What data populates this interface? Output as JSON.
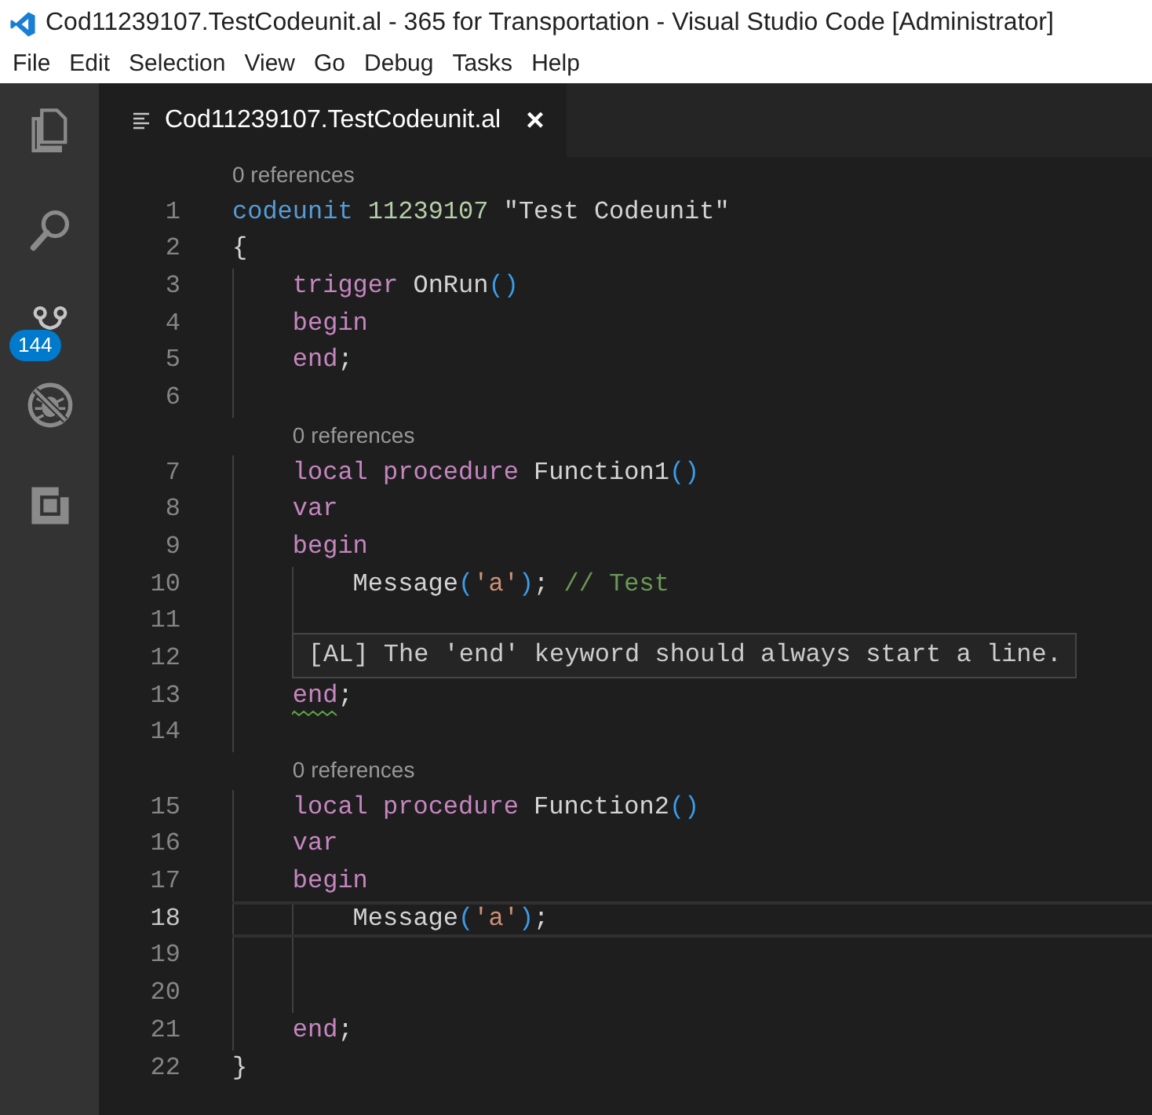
{
  "window": {
    "title": "Cod11239107.TestCodeunit.al - 365 for Transportation - Visual Studio Code [Administrator]"
  },
  "menu": [
    "File",
    "Edit",
    "Selection",
    "View",
    "Go",
    "Debug",
    "Tasks",
    "Help"
  ],
  "activity_bar": [
    {
      "kind": "files"
    },
    {
      "kind": "search"
    },
    {
      "kind": "source-control",
      "badge": "144"
    },
    {
      "kind": "debug"
    },
    {
      "kind": "extensions"
    }
  ],
  "tabs": [
    {
      "label": "Cod11239107.TestCodeunit.al",
      "close": "×",
      "selected": true
    }
  ],
  "lines": [
    {
      "number": "1",
      "lens": "0 references",
      "current": false,
      "tokens": [
        {
          "kind": "keyword",
          "text": "codeunit"
        },
        {
          "kind": "number",
          "text": " 11239107"
        },
        {
          "kind": "plain",
          "text": " \"Test Codeunit\""
        }
      ]
    },
    {
      "number": "2",
      "current": false,
      "tokens": [
        {
          "kind": "plain",
          "text": "{"
        }
      ],
      "children": [
        {
          "number": "3",
          "current": false,
          "tokens": [
            {
              "kind": "control",
              "text": "trigger"
            },
            {
              "kind": "plain",
              "text": " OnRun"
            },
            {
              "kind": "paren",
              "text": "()"
            }
          ]
        },
        {
          "number": "4",
          "current": false,
          "tokens": [
            {
              "kind": "control",
              "text": "begin"
            }
          ]
        },
        {
          "number": "5",
          "current": false,
          "tokens": [
            {
              "kind": "control",
              "text": "end"
            },
            {
              "kind": "plain",
              "text": ";"
            }
          ]
        },
        {
          "number": "6",
          "current": false
        },
        {
          "number": "7",
          "lens": "0 references",
          "current": false,
          "tokens": [
            {
              "kind": "control",
              "text": "local"
            },
            {
              "kind": "control",
              "text": " procedure"
            },
            {
              "kind": "plain",
              "text": " Function1"
            },
            {
              "kind": "paren",
              "text": "()"
            }
          ]
        },
        {
          "number": "8",
          "current": false,
          "tokens": [
            {
              "kind": "control",
              "text": "var"
            }
          ]
        },
        {
          "number": "9",
          "current": false,
          "tokens": [
            {
              "kind": "control",
              "text": "begin"
            }
          ],
          "children": [
            {
              "number": "10",
              "current": false,
              "tokens": [
                {
                  "kind": "plain",
                  "text": "Message"
                },
                {
                  "kind": "paren",
                  "text": "("
                },
                {
                  "kind": "string",
                  "text": "'a'"
                },
                {
                  "kind": "paren",
                  "text": ")"
                },
                {
                  "kind": "plain",
                  "text": ";"
                },
                {
                  "kind": "comment",
                  "text": " // Test"
                }
              ]
            },
            {
              "number": "11",
              "current": false
            },
            {
              "number": "12",
              "current": false,
              "hover": "[AL] The 'end' keyword should always start a line."
            }
          ]
        },
        {
          "number": "13",
          "current": false,
          "tokens": [
            {
              "kind": "control",
              "text": "end",
              "squiggle": true
            },
            {
              "kind": "plain",
              "text": ";"
            }
          ]
        },
        {
          "number": "14",
          "current": false
        },
        {
          "number": "15",
          "lens": "0 references",
          "current": false,
          "tokens": [
            {
              "kind": "control",
              "text": "local"
            },
            {
              "kind": "control",
              "text": " procedure"
            },
            {
              "kind": "plain",
              "text": " Function2"
            },
            {
              "kind": "paren",
              "text": "()"
            }
          ]
        },
        {
          "number": "16",
          "current": false,
          "tokens": [
            {
              "kind": "control",
              "text": "var"
            }
          ]
        },
        {
          "number": "17",
          "current": false,
          "tokens": [
            {
              "kind": "control",
              "text": "begin"
            }
          ],
          "children": [
            {
              "number": "18",
              "current": true,
              "tokens": [
                {
                  "kind": "plain",
                  "text": "Message"
                },
                {
                  "kind": "paren",
                  "text": "("
                },
                {
                  "kind": "string",
                  "text": "'a'"
                },
                {
                  "kind": "paren",
                  "text": ")"
                },
                {
                  "kind": "plain",
                  "text": ";"
                }
              ]
            },
            {
              "number": "19",
              "current": false
            },
            {
              "number": "20",
              "current": false
            }
          ]
        },
        {
          "number": "21",
          "current": false,
          "tokens": [
            {
              "kind": "control",
              "text": "end"
            },
            {
              "kind": "plain",
              "text": ";"
            }
          ]
        }
      ]
    },
    {
      "number": "22",
      "current": false,
      "tokens": [
        {
          "kind": "plain",
          "text": "}"
        }
      ]
    }
  ]
}
